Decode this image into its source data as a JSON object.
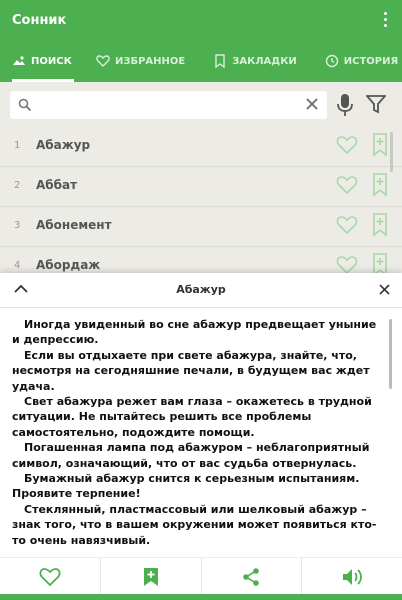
{
  "app": {
    "title": "Сонник"
  },
  "tabs": [
    {
      "label": "ПОИСК",
      "icon": "search-tab-icon"
    },
    {
      "label": "ИЗБРАННОЕ",
      "icon": "heart-icon"
    },
    {
      "label": "ЗАКЛАДКИ",
      "icon": "bookmark-icon"
    },
    {
      "label": "ИСТОРИЯ",
      "icon": "history-icon"
    }
  ],
  "search": {
    "value": "",
    "placeholder": ""
  },
  "list": [
    {
      "num": "1",
      "word": "Абажур"
    },
    {
      "num": "2",
      "word": "Аббат"
    },
    {
      "num": "3",
      "word": "Абонемент"
    },
    {
      "num": "4",
      "word": "Абордаж"
    }
  ],
  "dialog": {
    "title": "Абажур",
    "paragraphs": [
      "Иногда увиденный во сне абажур предвещает уныние и депрессию.",
      "Если вы отдыхаете при свете абажура, знайте, что, несмотря на сегодняшние печали, в будущем вас ждет удача.",
      "Свет абажура режет вам глаза – окажетесь в трудной ситуации. Не пытайтесь решить все проблемы самостоятельно, подождите помощи.",
      "Погашенная лампа под абажуром – неблагоприятный символ, означающий, что от вас судьба отвернулась.",
      "Бумажный абажур снится к серьезным испытаниям. Проявите терпение!",
      "Стеклянный, пластмассовый или шелковый абажур – знак того, что в вашем окружении может появиться кто-то очень навязчивый."
    ]
  },
  "colors": {
    "primary": "#4caf50",
    "icon_light": "#a8d8a8"
  }
}
